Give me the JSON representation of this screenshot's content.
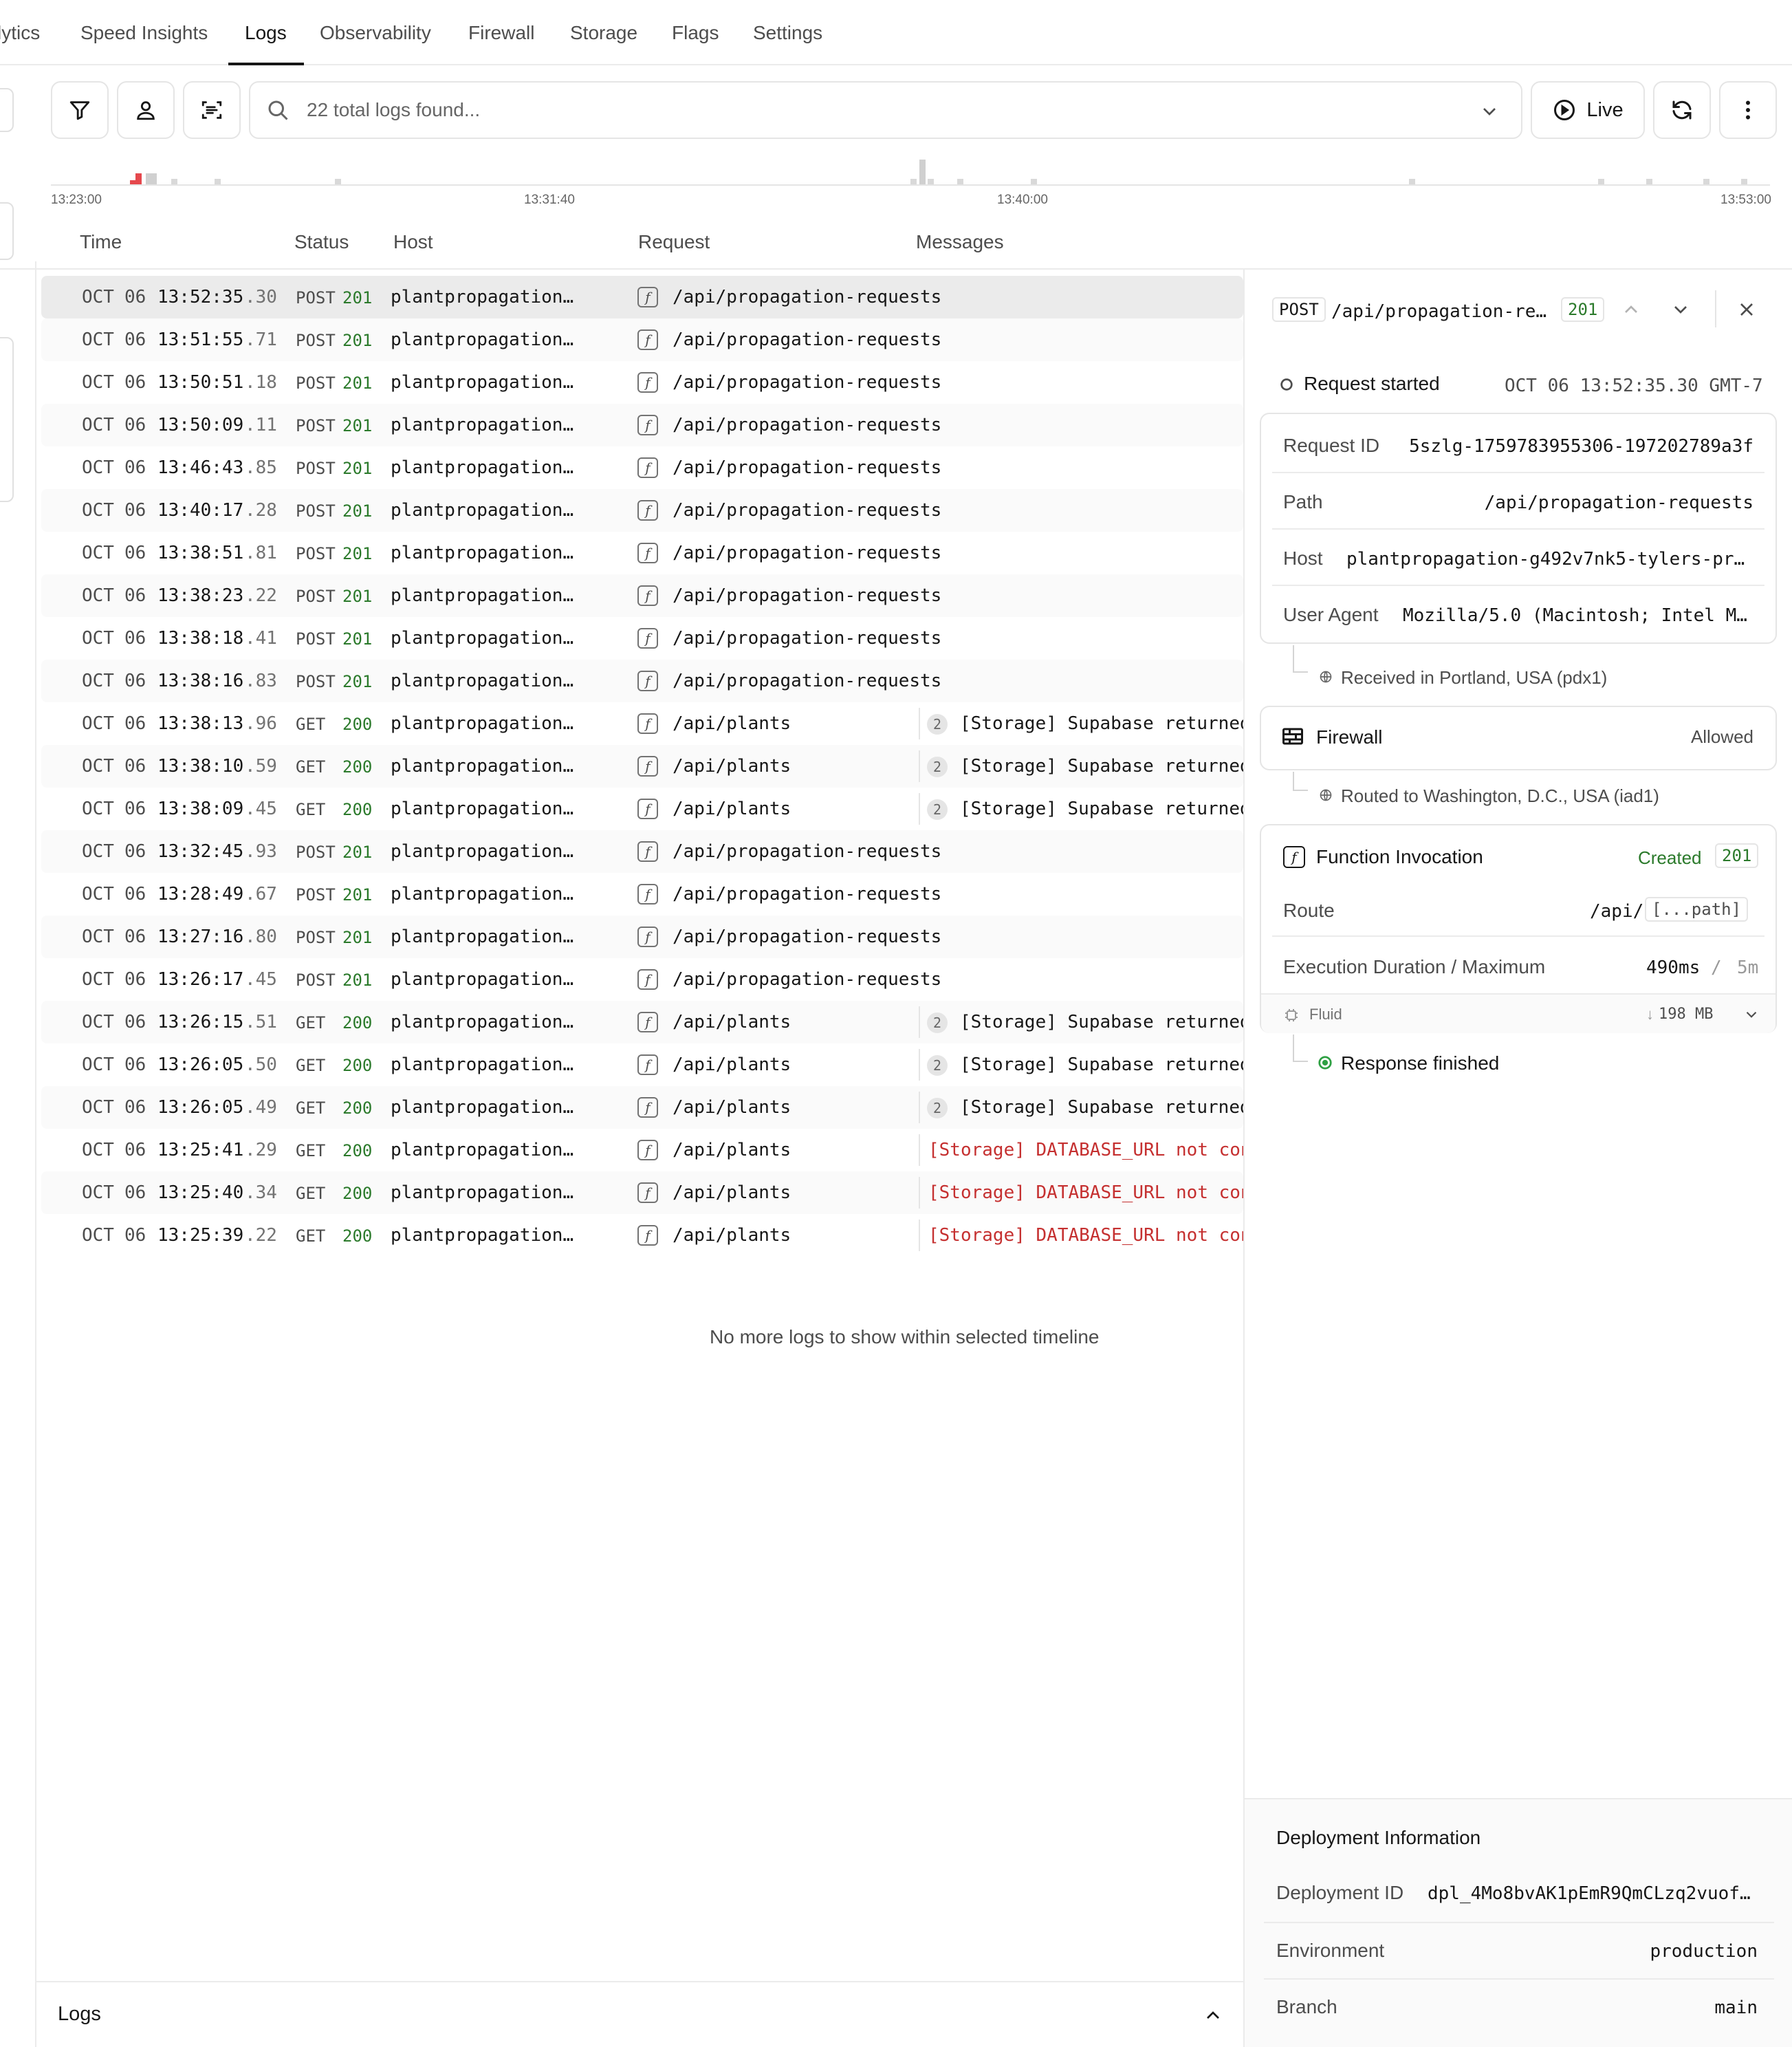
{
  "nav": {
    "tabs": [
      "lytics",
      "Speed Insights",
      "Logs",
      "Observability",
      "Firewall",
      "Storage",
      "Flags",
      "Settings"
    ],
    "active_tab": "Logs"
  },
  "toolbar": {
    "search_placeholder": "22 total logs found...",
    "live_label": "Live",
    "icons": [
      "filter-icon",
      "user-icon",
      "scan-text-icon",
      "search-icon",
      "chevron-down-icon",
      "play-circle-icon",
      "refresh-icon",
      "more-vertical-icon"
    ]
  },
  "timeline": {
    "ticks": [
      "13:23:00",
      "13:31:40",
      "13:40:00",
      "13:53:00"
    ],
    "bars": [
      {
        "pos": 0.046,
        "h": 6,
        "color": "#e5484d"
      },
      {
        "pos": 0.049,
        "h": 16,
        "color": "#e5484d"
      },
      {
        "pos": 0.055,
        "h": 16,
        "color": "#d0d0d0"
      },
      {
        "pos": 0.058,
        "h": 16,
        "color": "#d0d0d0"
      },
      {
        "pos": 0.07,
        "h": 8,
        "color": "#d9d9d9"
      },
      {
        "pos": 0.095,
        "h": 8,
        "color": "#d9d9d9"
      },
      {
        "pos": 0.165,
        "h": 8,
        "color": "#d9d9d9"
      },
      {
        "pos": 0.5,
        "h": 8,
        "color": "#d9d9d9"
      },
      {
        "pos": 0.505,
        "h": 36,
        "color": "#d0d0d0"
      },
      {
        "pos": 0.51,
        "h": 8,
        "color": "#d9d9d9"
      },
      {
        "pos": 0.527,
        "h": 8,
        "color": "#d9d9d9"
      },
      {
        "pos": 0.57,
        "h": 8,
        "color": "#d9d9d9"
      },
      {
        "pos": 0.79,
        "h": 8,
        "color": "#d9d9d9"
      },
      {
        "pos": 0.9,
        "h": 8,
        "color": "#d9d9d9"
      },
      {
        "pos": 0.928,
        "h": 8,
        "color": "#d9d9d9"
      },
      {
        "pos": 0.961,
        "h": 8,
        "color": "#d9d9d9"
      },
      {
        "pos": 0.983,
        "h": 8,
        "color": "#d9d9d9"
      }
    ]
  },
  "columns": [
    "Time",
    "Status",
    "Host",
    "Request",
    "Messages"
  ],
  "logs": [
    {
      "mon": "OCT",
      "day": "06",
      "time": "13:52:35",
      "frac": ".30",
      "method": "POST",
      "status": "201",
      "host": "plantpropagation…",
      "path": "/api/propagation-requests",
      "count": "",
      "msg": "",
      "err": false
    },
    {
      "mon": "OCT",
      "day": "06",
      "time": "13:51:55",
      "frac": ".71",
      "method": "POST",
      "status": "201",
      "host": "plantpropagation…",
      "path": "/api/propagation-requests",
      "count": "",
      "msg": "",
      "err": false
    },
    {
      "mon": "OCT",
      "day": "06",
      "time": "13:50:51",
      "frac": ".18",
      "method": "POST",
      "status": "201",
      "host": "plantpropagation…",
      "path": "/api/propagation-requests",
      "count": "",
      "msg": "",
      "err": false
    },
    {
      "mon": "OCT",
      "day": "06",
      "time": "13:50:09",
      "frac": ".11",
      "method": "POST",
      "status": "201",
      "host": "plantpropagation…",
      "path": "/api/propagation-requests",
      "count": "",
      "msg": "",
      "err": false
    },
    {
      "mon": "OCT",
      "day": "06",
      "time": "13:46:43",
      "frac": ".85",
      "method": "POST",
      "status": "201",
      "host": "plantpropagation…",
      "path": "/api/propagation-requests",
      "count": "",
      "msg": "",
      "err": false
    },
    {
      "mon": "OCT",
      "day": "06",
      "time": "13:40:17",
      "frac": ".28",
      "method": "POST",
      "status": "201",
      "host": "plantpropagation…",
      "path": "/api/propagation-requests",
      "count": "",
      "msg": "",
      "err": false
    },
    {
      "mon": "OCT",
      "day": "06",
      "time": "13:38:51",
      "frac": ".81",
      "method": "POST",
      "status": "201",
      "host": "plantpropagation…",
      "path": "/api/propagation-requests",
      "count": "",
      "msg": "",
      "err": false
    },
    {
      "mon": "OCT",
      "day": "06",
      "time": "13:38:23",
      "frac": ".22",
      "method": "POST",
      "status": "201",
      "host": "plantpropagation…",
      "path": "/api/propagation-requests",
      "count": "",
      "msg": "",
      "err": false
    },
    {
      "mon": "OCT",
      "day": "06",
      "time": "13:38:18",
      "frac": ".41",
      "method": "POST",
      "status": "201",
      "host": "plantpropagation…",
      "path": "/api/propagation-requests",
      "count": "",
      "msg": "",
      "err": false
    },
    {
      "mon": "OCT",
      "day": "06",
      "time": "13:38:16",
      "frac": ".83",
      "method": "POST",
      "status": "201",
      "host": "plantpropagation…",
      "path": "/api/propagation-requests",
      "count": "",
      "msg": "",
      "err": false
    },
    {
      "mon": "OCT",
      "day": "06",
      "time": "13:38:13",
      "frac": ".96",
      "method": "GET",
      "status": "200",
      "host": "plantpropagation…",
      "path": "/api/plants",
      "count": "2",
      "msg": "[Storage] Supabase returned",
      "err": false
    },
    {
      "mon": "OCT",
      "day": "06",
      "time": "13:38:10",
      "frac": ".59",
      "method": "GET",
      "status": "200",
      "host": "plantpropagation…",
      "path": "/api/plants",
      "count": "2",
      "msg": "[Storage] Supabase returned",
      "err": false
    },
    {
      "mon": "OCT",
      "day": "06",
      "time": "13:38:09",
      "frac": ".45",
      "method": "GET",
      "status": "200",
      "host": "plantpropagation…",
      "path": "/api/plants",
      "count": "2",
      "msg": "[Storage] Supabase returned",
      "err": false
    },
    {
      "mon": "OCT",
      "day": "06",
      "time": "13:32:45",
      "frac": ".93",
      "method": "POST",
      "status": "201",
      "host": "plantpropagation…",
      "path": "/api/propagation-requests",
      "count": "",
      "msg": "",
      "err": false
    },
    {
      "mon": "OCT",
      "day": "06",
      "time": "13:28:49",
      "frac": ".67",
      "method": "POST",
      "status": "201",
      "host": "plantpropagation…",
      "path": "/api/propagation-requests",
      "count": "",
      "msg": "",
      "err": false
    },
    {
      "mon": "OCT",
      "day": "06",
      "time": "13:27:16",
      "frac": ".80",
      "method": "POST",
      "status": "201",
      "host": "plantpropagation…",
      "path": "/api/propagation-requests",
      "count": "",
      "msg": "",
      "err": false
    },
    {
      "mon": "OCT",
      "day": "06",
      "time": "13:26:17",
      "frac": ".45",
      "method": "POST",
      "status": "201",
      "host": "plantpropagation…",
      "path": "/api/propagation-requests",
      "count": "",
      "msg": "",
      "err": false
    },
    {
      "mon": "OCT",
      "day": "06",
      "time": "13:26:15",
      "frac": ".51",
      "method": "GET",
      "status": "200",
      "host": "plantpropagation…",
      "path": "/api/plants",
      "count": "2",
      "msg": "[Storage] Supabase returned",
      "err": false
    },
    {
      "mon": "OCT",
      "day": "06",
      "time": "13:26:05",
      "frac": ".50",
      "method": "GET",
      "status": "200",
      "host": "plantpropagation…",
      "path": "/api/plants",
      "count": "2",
      "msg": "[Storage] Supabase returned",
      "err": false
    },
    {
      "mon": "OCT",
      "day": "06",
      "time": "13:26:05",
      "frac": ".49",
      "method": "GET",
      "status": "200",
      "host": "plantpropagation…",
      "path": "/api/plants",
      "count": "2",
      "msg": "[Storage] Supabase returned",
      "err": false
    },
    {
      "mon": "OCT",
      "day": "06",
      "time": "13:25:41",
      "frac": ".29",
      "method": "GET",
      "status": "200",
      "host": "plantpropagation…",
      "path": "/api/plants",
      "count": "",
      "msg": "[Storage] DATABASE_URL not con",
      "err": true
    },
    {
      "mon": "OCT",
      "day": "06",
      "time": "13:25:40",
      "frac": ".34",
      "method": "GET",
      "status": "200",
      "host": "plantpropagation…",
      "path": "/api/plants",
      "count": "",
      "msg": "[Storage] DATABASE_URL not con",
      "err": true
    },
    {
      "mon": "OCT",
      "day": "06",
      "time": "13:25:39",
      "frac": ".22",
      "method": "GET",
      "status": "200",
      "host": "plantpropagation…",
      "path": "/api/plants",
      "count": "",
      "msg": "[Storage] DATABASE_URL not con",
      "err": true
    }
  ],
  "no_more_text": "No more logs to show within selected timeline",
  "bottom_bar": {
    "label": "Logs"
  },
  "detail": {
    "method": "POST",
    "path": "/api/propagation-re…",
    "status": "201",
    "request_started_label": "Request started",
    "request_started_time": "OCT 06 13:52:35.30 GMT-7",
    "request_id_label": "Request ID",
    "request_id": "5szlg-1759783955306-197202789a3f",
    "path_label": "Path",
    "path_full": "/api/propagation-requests",
    "host_label": "Host",
    "host": "plantpropagation-g492v7nk5-tylers-pr…",
    "user_agent_label": "User Agent",
    "user_agent": "Mozilla/5.0 (Macintosh; Intel M…",
    "received_text": "Received in Portland, USA (pdx1)",
    "firewall_label": "Firewall",
    "firewall_status": "Allowed",
    "routed_text": "Routed to Washington, D.C., USA (iad1)",
    "function_label": "Function Invocation",
    "function_status_label": "Created",
    "function_status": "201",
    "route_label": "Route",
    "route_prefix": "/api/",
    "route_param": "[...path]",
    "exec_label": "Execution Duration / Maximum",
    "exec_value": "490ms",
    "exec_sep": "/",
    "exec_max": "5m",
    "fluid_label": "Fluid",
    "memory_arrow": "↓",
    "memory": "198 MB",
    "response_finished": "Response finished",
    "deployment_title": "Deployment Information",
    "deployment_id_label": "Deployment ID",
    "deployment_id": "dpl_4Mo8bvAK1pEmR9QmCLzq2vuof…",
    "environment_label": "Environment",
    "environment": "production",
    "branch_label": "Branch",
    "branch": "main"
  },
  "colors": {
    "status_ok": "#2b7a2b",
    "error": "#c53030",
    "success_dot": "#2ea043",
    "spike": "#e5484d"
  }
}
